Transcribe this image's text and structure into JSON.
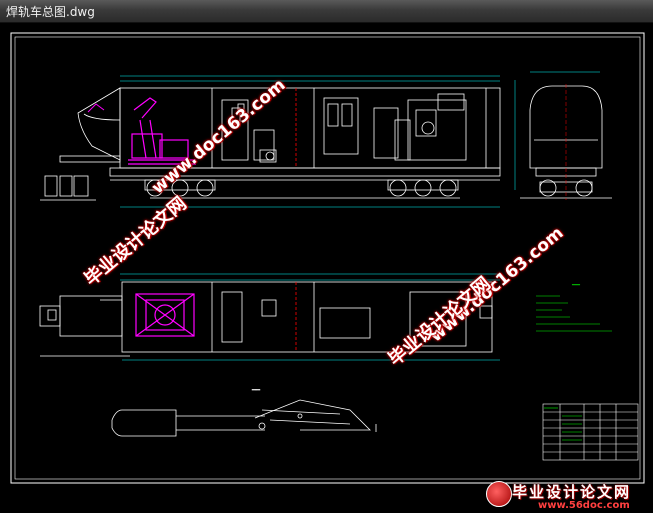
{
  "window": {
    "title": "焊轨车总图.dwg"
  },
  "watermarks": {
    "site_url": "www.doc163.com",
    "site_name": "毕业设计论文网"
  },
  "badge": {
    "main": "毕业设计论文网",
    "sub": "www.56doc.com"
  },
  "colors": {
    "drawing_frame": "#ffffff",
    "mechanism": "#ff00ff",
    "dimension": "#00ffff",
    "notes": "#00ff00"
  }
}
